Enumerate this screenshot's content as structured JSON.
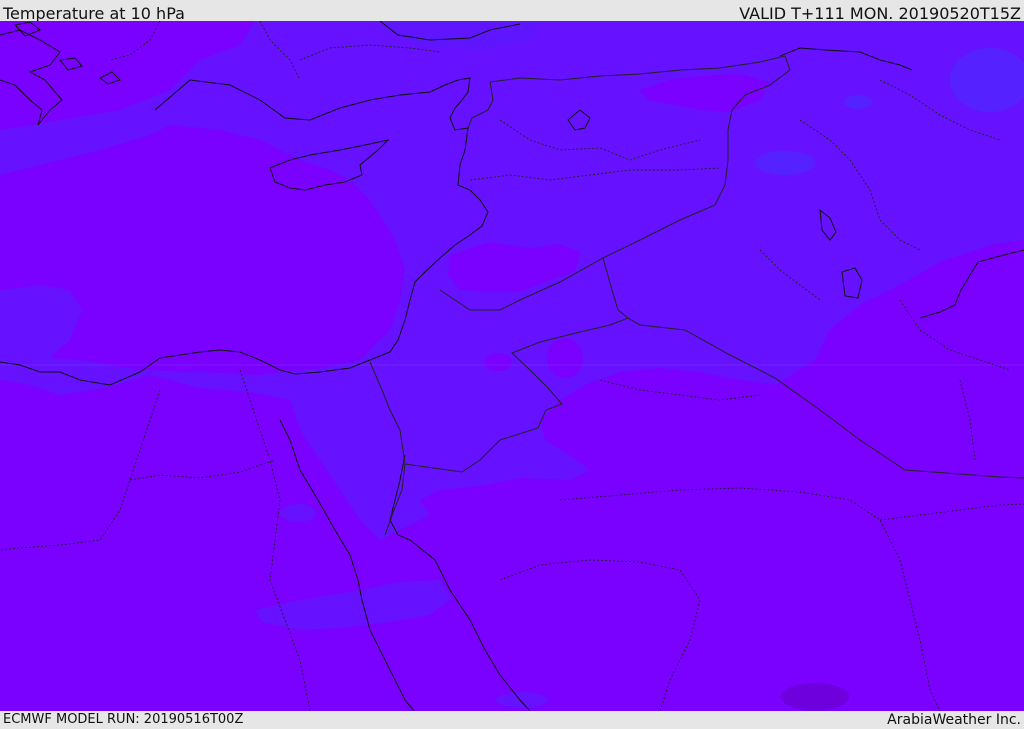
{
  "header": {
    "title": "Temperature at 10 hPa",
    "valid": "VALID T+111 MON. 20190520T15Z"
  },
  "footer": {
    "model_run": "ECMWF MODEL RUN: 20190516T00Z",
    "credit": "ArabiaWeather Inc."
  },
  "map": {
    "field": "temperature",
    "level": "10 hPa",
    "colors": {
      "background_purple": "#7a00ff",
      "violet_blue": "#6611ff",
      "blue_band": "#5522ff",
      "coastline": "#111111",
      "border": "#222222"
    },
    "legend": "none"
  }
}
